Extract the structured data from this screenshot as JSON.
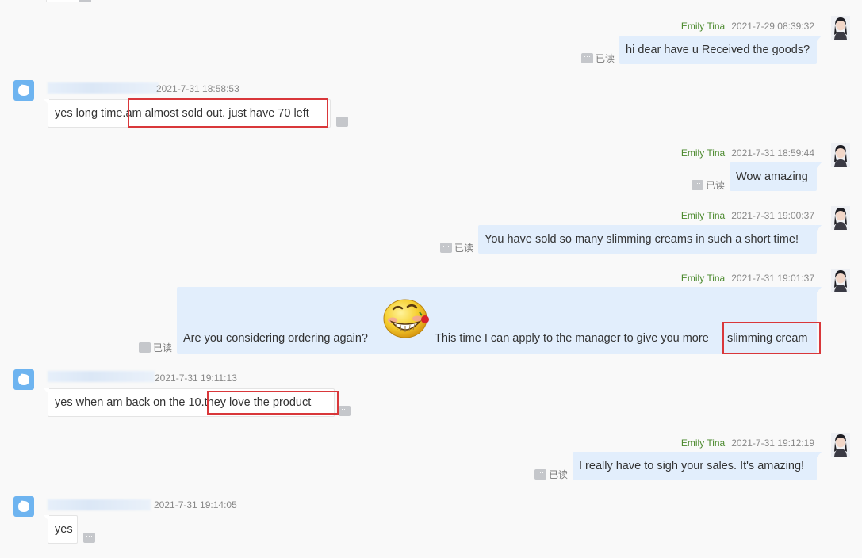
{
  "app": {
    "read_label": "已读",
    "more_glyph": "···",
    "colors": {
      "outgoing_bubble": "#e2eefc",
      "incoming_bubble": "#ffffff",
      "name": "#4c8a2e",
      "highlight": "#d9373a",
      "avatar": "#6eb4f0"
    }
  },
  "messages": [
    {
      "sender": "Emily Tina",
      "time": "2021-7-29 08:39:32",
      "text": "hi dear have u Received the goods?"
    },
    {
      "sender": "",
      "time": "2021-7-31 18:58:53",
      "text_before": "yes long time.",
      "text_highlight": "am almost sold out. just have 70 left"
    },
    {
      "sender": "Emily Tina",
      "time": "2021-7-31 18:59:44",
      "text": "Wow amazing"
    },
    {
      "sender": "Emily Tina",
      "time": "2021-7-31 19:00:37",
      "text": "You have sold so many slimming creams in such a short time!"
    },
    {
      "sender": "Emily Tina",
      "time": "2021-7-31 19:01:37",
      "text_before": "Are you considering ordering again?",
      "emoji": "grinning-emoji",
      "text_after": "This time I can apply to the manager to give you more",
      "text_highlight": "slimming cream"
    },
    {
      "sender": "",
      "time": "2021-7-31 19:11:13",
      "text_before": "yes when am back on the 10.",
      "text_highlight": "they love the product"
    },
    {
      "sender": "Emily Tina",
      "time": "2021-7-31 19:12:19",
      "text": "I really have to sigh your sales. It's amazing!"
    },
    {
      "sender": "",
      "time": "2021-7-31 19:14:05",
      "text": "yes"
    }
  ]
}
